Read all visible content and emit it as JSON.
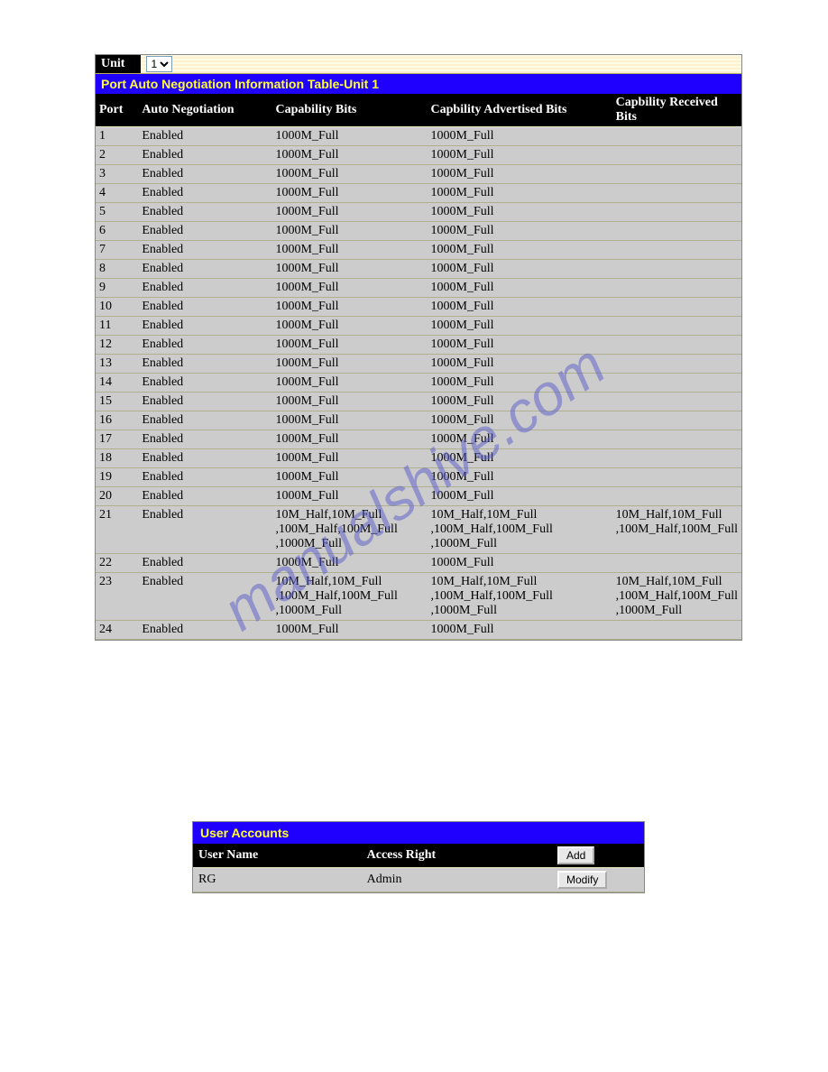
{
  "watermark": "manualshive.com",
  "unit": {
    "label": "Unit",
    "selected": "1"
  },
  "port_table": {
    "title": "Port Auto Negotiation Information Table-Unit 1",
    "columns": [
      "Port",
      "Auto Negotiation",
      "Capability Bits",
      "Capbility Advertised Bits",
      "Capbility Received Bits"
    ],
    "rows": [
      {
        "port": "1",
        "auto": "Enabled",
        "cap": "1000M_Full",
        "adv": "1000M_Full",
        "recv": ""
      },
      {
        "port": "2",
        "auto": "Enabled",
        "cap": "1000M_Full",
        "adv": "1000M_Full",
        "recv": ""
      },
      {
        "port": "3",
        "auto": "Enabled",
        "cap": "1000M_Full",
        "adv": "1000M_Full",
        "recv": ""
      },
      {
        "port": "4",
        "auto": "Enabled",
        "cap": "1000M_Full",
        "adv": "1000M_Full",
        "recv": ""
      },
      {
        "port": "5",
        "auto": "Enabled",
        "cap": "1000M_Full",
        "adv": "1000M_Full",
        "recv": ""
      },
      {
        "port": "6",
        "auto": "Enabled",
        "cap": "1000M_Full",
        "adv": "1000M_Full",
        "recv": ""
      },
      {
        "port": "7",
        "auto": "Enabled",
        "cap": "1000M_Full",
        "adv": "1000M_Full",
        "recv": ""
      },
      {
        "port": "8",
        "auto": "Enabled",
        "cap": "1000M_Full",
        "adv": "1000M_Full",
        "recv": ""
      },
      {
        "port": "9",
        "auto": "Enabled",
        "cap": "1000M_Full",
        "adv": "1000M_Full",
        "recv": ""
      },
      {
        "port": "10",
        "auto": "Enabled",
        "cap": "1000M_Full",
        "adv": "1000M_Full",
        "recv": ""
      },
      {
        "port": "11",
        "auto": "Enabled",
        "cap": "1000M_Full",
        "adv": "1000M_Full",
        "recv": ""
      },
      {
        "port": "12",
        "auto": "Enabled",
        "cap": "1000M_Full",
        "adv": "1000M_Full",
        "recv": ""
      },
      {
        "port": "13",
        "auto": "Enabled",
        "cap": "1000M_Full",
        "adv": "1000M_Full",
        "recv": ""
      },
      {
        "port": "14",
        "auto": "Enabled",
        "cap": "1000M_Full",
        "adv": "1000M_Full",
        "recv": ""
      },
      {
        "port": "15",
        "auto": "Enabled",
        "cap": "1000M_Full",
        "adv": "1000M_Full",
        "recv": ""
      },
      {
        "port": "16",
        "auto": "Enabled",
        "cap": "1000M_Full",
        "adv": "1000M_Full",
        "recv": ""
      },
      {
        "port": "17",
        "auto": "Enabled",
        "cap": "1000M_Full",
        "adv": "1000M_Full",
        "recv": ""
      },
      {
        "port": "18",
        "auto": "Enabled",
        "cap": "1000M_Full",
        "adv": "1000M_Full",
        "recv": ""
      },
      {
        "port": "19",
        "auto": "Enabled",
        "cap": "1000M_Full",
        "adv": "1000M_Full",
        "recv": ""
      },
      {
        "port": "20",
        "auto": "Enabled",
        "cap": "1000M_Full",
        "adv": "1000M_Full",
        "recv": ""
      },
      {
        "port": "21",
        "auto": "Enabled",
        "cap": "10M_Half,10M_Full\n,100M_Half,100M_Full\n,1000M_Full",
        "adv": "10M_Half,10M_Full\n,100M_Half,100M_Full\n,1000M_Full",
        "recv": "10M_Half,10M_Full\n,100M_Half,100M_Full"
      },
      {
        "port": "22",
        "auto": "Enabled",
        "cap": "1000M_Full",
        "adv": "1000M_Full",
        "recv": ""
      },
      {
        "port": "23",
        "auto": "Enabled",
        "cap": "10M_Half,10M_Full\n,100M_Half,100M_Full\n,1000M_Full",
        "adv": "10M_Half,10M_Full\n,100M_Half,100M_Full\n,1000M_Full",
        "recv": "10M_Half,10M_Full\n,100M_Half,100M_Full\n,1000M_Full"
      },
      {
        "port": "24",
        "auto": "Enabled",
        "cap": "1000M_Full",
        "adv": "1000M_Full",
        "recv": ""
      }
    ]
  },
  "user_accounts": {
    "title": "User Accounts",
    "columns": [
      "User Name",
      "Access Right"
    ],
    "add_label": "Add",
    "modify_label": "Modify",
    "rows": [
      {
        "user": "RG",
        "access": "Admin"
      }
    ]
  }
}
